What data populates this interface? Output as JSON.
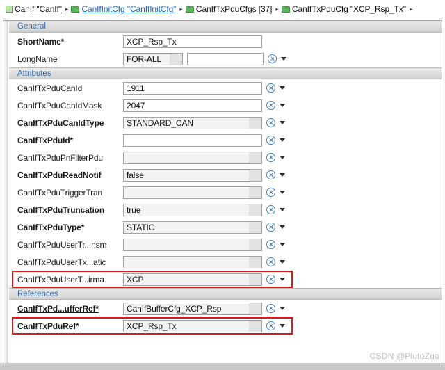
{
  "breadcrumb": {
    "items": [
      {
        "label": "CanIf \"CanIf\"",
        "icon": "square-icon",
        "style": "dark"
      },
      {
        "label": "CanIfInitCfg \"CanIfInitCfg\"",
        "icon": "folder-icon",
        "style": "link"
      },
      {
        "label": "CanIfTxPduCfgs [37]",
        "icon": "folder-icon",
        "style": "dark"
      },
      {
        "label": "CanIfTxPduCfg \"XCP_Rsp_Tx\"",
        "icon": "folder-icon",
        "style": "dark"
      }
    ],
    "separator": "▸"
  },
  "sections": [
    {
      "title": "General",
      "rows": [
        {
          "label": "ShortName*",
          "bold": true,
          "field": "XCP_Rsp_Tx",
          "field_kind": "plain",
          "field_width": "w-long",
          "has_reset": false,
          "has_caret": false,
          "highlight": false
        },
        {
          "label": "LongName",
          "bold": false,
          "field": "FOR-ALL",
          "field_kind": "combo",
          "field_width": "w-short",
          "second_field": "",
          "has_reset": true,
          "has_caret": true,
          "highlight": false
        }
      ]
    },
    {
      "title": "Attributes",
      "rows": [
        {
          "label": "CanIfTxPduCanId",
          "bold": false,
          "field": "1911",
          "field_kind": "plain",
          "field_width": "w-long",
          "has_reset": true,
          "has_caret": true,
          "highlight": false
        },
        {
          "label": "CanIfTxPduCanIdMask",
          "bold": false,
          "field": "2047",
          "field_kind": "plain",
          "field_width": "w-long",
          "has_reset": true,
          "has_caret": true,
          "highlight": false
        },
        {
          "label": "CanIfTxPduCanIdType",
          "bold": true,
          "field": "STANDARD_CAN",
          "field_kind": "combo",
          "field_width": "w-long",
          "has_reset": true,
          "has_caret": true,
          "highlight": false
        },
        {
          "label": "CanIfTxPduId*",
          "bold": true,
          "field": "",
          "field_kind": "plain",
          "field_width": "w-long",
          "has_reset": true,
          "has_caret": true,
          "highlight": false
        },
        {
          "label": "CanIfTxPduPnFilterPdu",
          "bold": false,
          "field": "",
          "field_kind": "combo",
          "field_width": "w-long",
          "has_reset": true,
          "has_caret": true,
          "highlight": false
        },
        {
          "label": "CanIfTxPduReadNotif",
          "bold": true,
          "field": "false",
          "field_kind": "combo",
          "field_width": "w-long",
          "has_reset": true,
          "has_caret": true,
          "highlight": false
        },
        {
          "label": "CanIfTxPduTriggerTran",
          "bold": false,
          "field": "",
          "field_kind": "combo",
          "field_width": "w-long",
          "has_reset": true,
          "has_caret": true,
          "highlight": false
        },
        {
          "label": "CanIfTxPduTruncation",
          "bold": true,
          "field": "true",
          "field_kind": "combo",
          "field_width": "w-long",
          "has_reset": true,
          "has_caret": true,
          "highlight": false
        },
        {
          "label": "CanIfTxPduType*",
          "bold": true,
          "field": "STATIC",
          "field_kind": "combo",
          "field_width": "w-long",
          "has_reset": true,
          "has_caret": true,
          "highlight": false
        },
        {
          "label": "CanIfTxPduUserTr...nsm",
          "bold": false,
          "field": "",
          "field_kind": "combo",
          "field_width": "w-long",
          "has_reset": true,
          "has_caret": true,
          "highlight": false
        },
        {
          "label": "CanIfTxPduUserTx...atic",
          "bold": false,
          "field": "",
          "field_kind": "combo",
          "field_width": "w-long",
          "has_reset": true,
          "has_caret": true,
          "highlight": false
        },
        {
          "label": "CanIfTxPduUserT...irma",
          "bold": false,
          "field": "XCP",
          "field_kind": "combo",
          "field_width": "w-long",
          "has_reset": true,
          "has_caret": true,
          "highlight": true
        }
      ]
    },
    {
      "title": "References",
      "rows": [
        {
          "label": "CanIfTxPd...ufferRef*",
          "ref": true,
          "field": "CanIfBufferCfg_XCP_Rsp",
          "field_kind": "combo",
          "field_width": "w-long",
          "has_reset": true,
          "has_caret": true,
          "highlight": false
        },
        {
          "label": "CanIfTxPduRef*",
          "ref": true,
          "field": "XCP_Rsp_Tx",
          "field_kind": "combo",
          "field_width": "w-long",
          "has_reset": true,
          "has_caret": true,
          "highlight": true
        }
      ]
    }
  ],
  "watermark": "CSDN @PlutoZuo",
  "colors": {
    "section_title": "#3a6ea5",
    "highlight": "#e81313",
    "link": "#1765c2",
    "folder_green": "#5cb85c"
  }
}
